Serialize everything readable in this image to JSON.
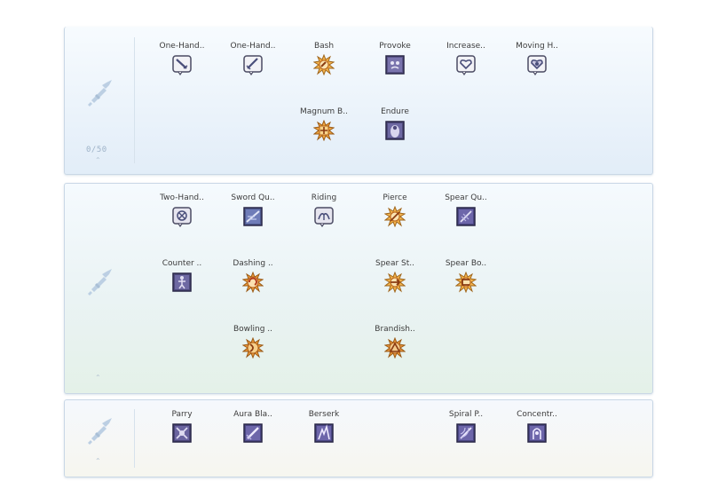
{
  "tiers": [
    {
      "points": "0/50",
      "skills": [
        {
          "label": "One-Hand..",
          "icon": "sword-bubble-icon"
        },
        {
          "label": "One-Hand..",
          "icon": "sword-bubble-icon"
        },
        {
          "label": "Bash",
          "icon": "bash-burst-icon"
        },
        {
          "label": "Provoke",
          "icon": "provoke-face-icon"
        },
        {
          "label": "Increase..",
          "icon": "heart-bubble-icon"
        },
        {
          "label": "Moving H..",
          "icon": "heart-bubble-icon"
        },
        {
          "label": "Magnum B..",
          "icon": "magnum-burst-icon"
        },
        {
          "label": "Endure",
          "icon": "endure-figure-icon"
        }
      ]
    },
    {
      "skills": [
        {
          "label": "Two-Hand..",
          "icon": "two-hand-bubble-icon"
        },
        {
          "label": "Sword Qu..",
          "icon": "sword-quicken-icon"
        },
        {
          "label": "Riding",
          "icon": "riding-bubble-icon"
        },
        {
          "label": "Pierce",
          "icon": "pierce-burst-icon"
        },
        {
          "label": "Spear Qu..",
          "icon": "spear-quicken-icon"
        },
        {
          "label": "Counter ..",
          "icon": "counter-figure-icon"
        },
        {
          "label": "Dashing ..",
          "icon": "dashing-burst-icon"
        },
        {
          "label": "Spear St..",
          "icon": "spear-stab-burst-icon"
        },
        {
          "label": "Spear Bo..",
          "icon": "spear-boomerang-burst-icon"
        },
        {
          "label": "Bowling ..",
          "icon": "bowling-bash-burst-icon"
        },
        {
          "label": "Brandish..",
          "icon": "brandish-burst-icon"
        }
      ]
    },
    {
      "skills": [
        {
          "label": "Parry",
          "icon": "parry-icon"
        },
        {
          "label": "Aura Bla..",
          "icon": "aura-blade-icon"
        },
        {
          "label": "Berserk",
          "icon": "berserk-icon"
        },
        {
          "label": "Spiral P..",
          "icon": "spiral-pierce-icon"
        },
        {
          "label": "Concentr..",
          "icon": "concentration-icon"
        }
      ]
    }
  ]
}
